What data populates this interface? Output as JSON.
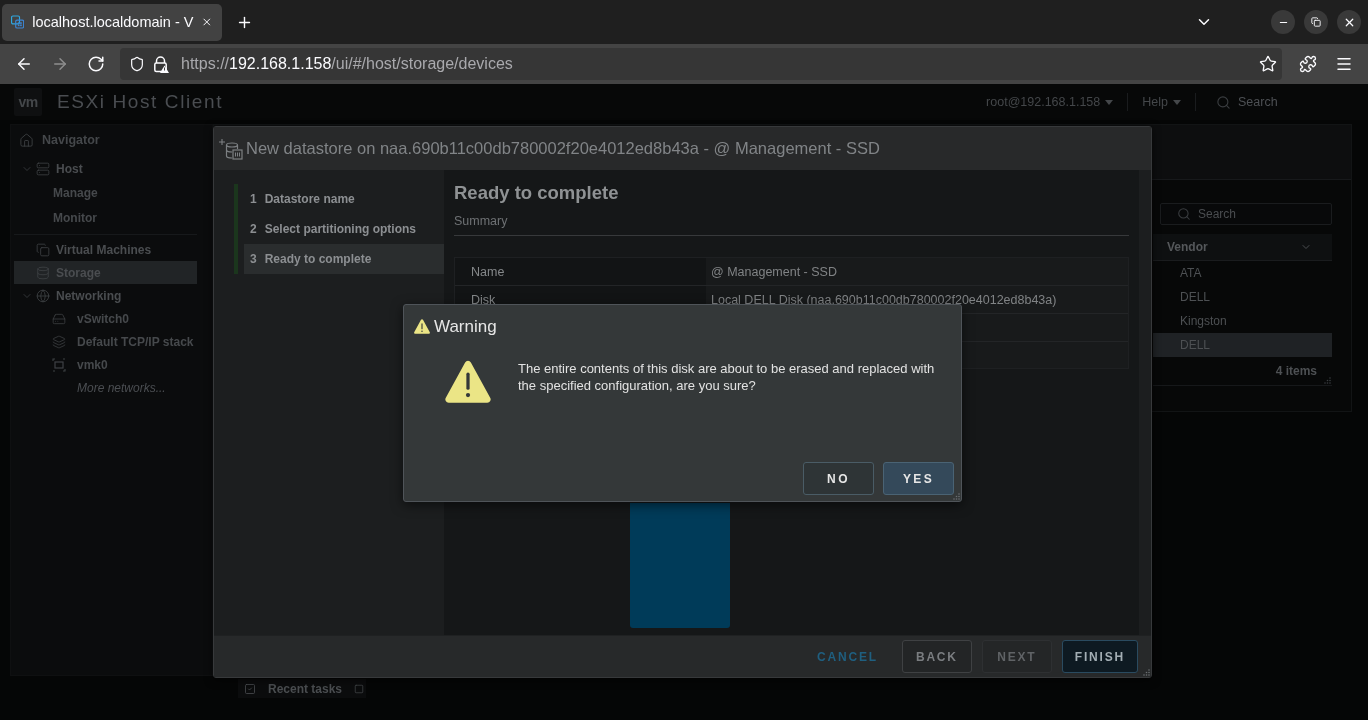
{
  "browser": {
    "tabs": [
      {
        "title": "localhost.localdomain - V",
        "selected": true
      }
    ],
    "nav_buttons": [
      {
        "kind": "back",
        "disabled": false
      },
      {
        "kind": "forward",
        "disabled": true
      },
      {
        "kind": "reload",
        "disabled": false
      }
    ],
    "url": {
      "scheme": "https://",
      "host": "192.168.1.158",
      "path": "/ui/#/host/storage/devices"
    }
  },
  "header": {
    "logo": "vm",
    "product": "ESXi Host Client",
    "user": "root@192.168.1.158",
    "help": "Help",
    "search": {
      "placeholder": "Search"
    }
  },
  "navigator": {
    "title": "Navigator",
    "items": [
      {
        "label": "Host",
        "selected": false,
        "expanded": true,
        "children": [
          {
            "label": "Manage",
            "selected": false
          },
          {
            "label": "Monitor",
            "selected": false
          }
        ]
      },
      {
        "label": "Virtual Machines",
        "selected": false
      },
      {
        "label": "Storage",
        "selected": true
      },
      {
        "label": "Networking",
        "selected": false,
        "expanded": true,
        "children": [
          {
            "label": "vSwitch0",
            "kind": "item",
            "selected": false
          },
          {
            "label": "Default TCP/IP stack",
            "kind": "item",
            "selected": false
          },
          {
            "label": "vmk0",
            "kind": "item",
            "selected": false
          },
          {
            "label": "More networks...",
            "kind": "link",
            "selected": false
          }
        ]
      }
    ]
  },
  "content": {
    "search": {
      "placeholder": "Search"
    },
    "columns": [
      {
        "label": "Vendor"
      }
    ],
    "rows": [
      {
        "vendor": "ATA",
        "selected": false
      },
      {
        "vendor": "DELL",
        "selected": false
      },
      {
        "vendor": "Kingston",
        "selected": false
      },
      {
        "vendor": "DELL",
        "selected": true
      }
    ],
    "footer": "4 items"
  },
  "recent_tasks": {
    "label": "Recent tasks"
  },
  "wizard": {
    "title": "New datastore on naa.690b11c00db780002f20e4012ed8b43a - @ Management - SSD",
    "steps": [
      {
        "number": "1",
        "label": "Datastore name",
        "selected": false
      },
      {
        "number": "2",
        "label": "Select partitioning options",
        "selected": false
      },
      {
        "number": "3",
        "label": "Ready to complete",
        "selected": true
      }
    ],
    "heading": "Ready to complete",
    "subheading": "Summary",
    "summary": [
      {
        "label": "Name",
        "value": "@ Management - SSD"
      },
      {
        "label": "Disk",
        "value": "Local DELL Disk (naa.690b11c00db780002f20e4012ed8b43a)"
      }
    ],
    "buttons": [
      {
        "label": "CANCEL",
        "kind": "link",
        "disabled": false
      },
      {
        "label": "BACK",
        "kind": "secondary",
        "disabled": false
      },
      {
        "label": "NEXT",
        "kind": "secondary",
        "disabled": true
      },
      {
        "label": "FINISH",
        "kind": "primary",
        "disabled": false
      }
    ]
  },
  "warning": {
    "title": "Warning",
    "message": "The entire contents of this disk are about to be erased and replaced with the specified configuration, are you sure?",
    "buttons": [
      {
        "label": "NO",
        "kind": "secondary"
      },
      {
        "label": "YES",
        "kind": "primary"
      }
    ]
  }
}
